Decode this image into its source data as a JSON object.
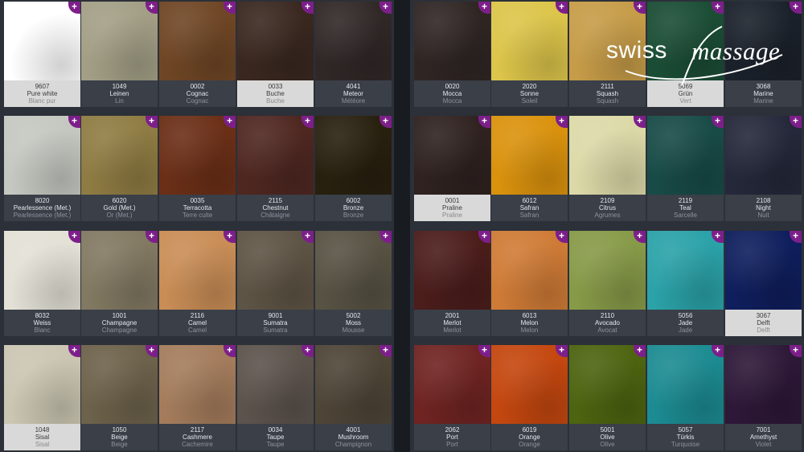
{
  "logo": {
    "word1": "swiss",
    "word2": "massage"
  },
  "panels": [
    {
      "rows": [
        [
          {
            "code": "9607",
            "name": "Pure white",
            "sub": "Blanc pur",
            "color": "#ffffff",
            "light": true
          },
          {
            "code": "1049",
            "name": "Leinen",
            "sub": "Lin",
            "color": "#a39f86",
            "light": false
          },
          {
            "code": "0002",
            "name": "Cognac",
            "sub": "Cognac",
            "color": "#6f4625",
            "light": false
          },
          {
            "code": "0033",
            "name": "Buche",
            "sub": "Buche",
            "color": "#3a2820",
            "light": true
          },
          {
            "code": "4041",
            "name": "Meteor",
            "sub": "Météore",
            "color": "#302827",
            "light": false
          }
        ],
        [
          {
            "code": "8020",
            "name": "Pearlessence (Met.)",
            "sub": "Pearlessence (Met.)",
            "color": "#c5c8c1",
            "light": false
          },
          {
            "code": "6020",
            "name": "Gold (Met.)",
            "sub": "Or (Met.)",
            "color": "#8f7c43",
            "light": false
          },
          {
            "code": "0035",
            "name": "Terracotta",
            "sub": "Terre cuite",
            "color": "#6b2f17",
            "light": false
          },
          {
            "code": "2115",
            "name": "Chestnut",
            "sub": "Châtaigne",
            "color": "#4f2721",
            "light": false
          },
          {
            "code": "6002",
            "name": "Bronze",
            "sub": "Bronze",
            "color": "#28200f",
            "light": false
          }
        ],
        [
          {
            "code": "8032",
            "name": "Weiss",
            "sub": "Blanc",
            "color": "#e3e1d6",
            "light": false
          },
          {
            "code": "1001",
            "name": "Champagne",
            "sub": "Champagne",
            "color": "#827962",
            "light": false
          },
          {
            "code": "2116",
            "name": "Camel",
            "sub": "Camel",
            "color": "#c98d56",
            "light": false
          },
          {
            "code": "9001",
            "name": "Sumatra",
            "sub": "Sumatra",
            "color": "#5e5445",
            "light": false
          },
          {
            "code": "5002",
            "name": "Moss",
            "sub": "Mousse",
            "color": "#575243",
            "light": false
          }
        ],
        [
          {
            "code": "1048",
            "name": "Sisal",
            "sub": "Sisal",
            "color": "#cbc6b2",
            "light": true
          },
          {
            "code": "1050",
            "name": "Beige",
            "sub": "Beige",
            "color": "#6d624b",
            "light": false
          },
          {
            "code": "2117",
            "name": "Cashmere",
            "sub": "Cachemire",
            "color": "#a47c5c",
            "light": false
          },
          {
            "code": "0034",
            "name": "Taupe",
            "sub": "Taupe",
            "color": "#5c534c",
            "light": false
          },
          {
            "code": "4001",
            "name": "Mushroom",
            "sub": "Champignon",
            "color": "#4e4537",
            "light": false
          }
        ]
      ]
    },
    {
      "rows": [
        [
          {
            "code": "0020",
            "name": "Mocca",
            "sub": "Mocca",
            "color": "#2f2624",
            "light": false
          },
          {
            "code": "2020",
            "name": "Sonne",
            "sub": "Soleil",
            "color": "#dcc54a",
            "light": false
          },
          {
            "code": "2111",
            "name": "Squash",
            "sub": "Squash",
            "color": "#c69c48",
            "light": false
          },
          {
            "code": "5069",
            "name": "Grün",
            "sub": "Vert",
            "color": "#1b4d35",
            "light": true
          },
          {
            "code": "3068",
            "name": "Marine",
            "sub": "Marine",
            "color": "#1b212b",
            "light": false
          }
        ],
        [
          {
            "code": "0001",
            "name": "Praline",
            "sub": "Praline",
            "color": "#2f2220",
            "light": true
          },
          {
            "code": "6012",
            "name": "Safran",
            "sub": "Safran",
            "color": "#da920d",
            "light": false
          },
          {
            "code": "2109",
            "name": "Citrus",
            "sub": "Agrumes",
            "color": "#dcd9a8",
            "light": false
          },
          {
            "code": "2119",
            "name": "Teal",
            "sub": "Sarcelle",
            "color": "#184b47",
            "light": false
          },
          {
            "code": "2108",
            "name": "Night",
            "sub": "Nuit",
            "color": "#24283a",
            "light": false
          }
        ],
        [
          {
            "code": "2001",
            "name": "Merlot",
            "sub": "Merlot",
            "color": "#4b1d1b",
            "light": false
          },
          {
            "code": "6013",
            "name": "Melon",
            "sub": "Melon",
            "color": "#cf7b36",
            "light": false
          },
          {
            "code": "2110",
            "name": "Avocado",
            "sub": "Avocat",
            "color": "#879a48",
            "light": false
          },
          {
            "code": "5056",
            "name": "Jade",
            "sub": "Jade",
            "color": "#2aa2a8",
            "light": false
          },
          {
            "code": "3067",
            "name": "Delft",
            "sub": "Delft",
            "color": "#0f1e5d",
            "light": true
          }
        ],
        [
          {
            "code": "2062",
            "name": "Port",
            "sub": "Port",
            "color": "#6f2422",
            "light": false
          },
          {
            "code": "6019",
            "name": "Orange",
            "sub": "Orange",
            "color": "#c4470f",
            "light": false
          },
          {
            "code": "5001",
            "name": "Olive",
            "sub": "Olive",
            "color": "#4d6410",
            "light": false
          },
          {
            "code": "5057",
            "name": "Türkis",
            "sub": "Turquoise",
            "color": "#1c8b92",
            "light": false
          },
          {
            "code": "7001",
            "name": "Amethyst",
            "sub": "Violet",
            "color": "#2d1838",
            "light": false
          }
        ]
      ]
    }
  ]
}
